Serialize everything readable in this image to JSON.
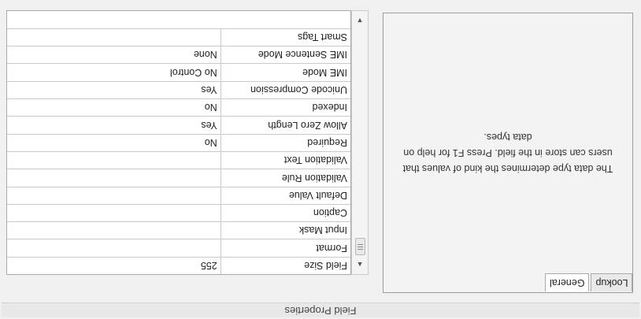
{
  "section_title": "Field Properties",
  "tabs": [
    {
      "label": "General",
      "active": true
    },
    {
      "label": "Lookup",
      "active": false
    }
  ],
  "properties": [
    {
      "name": "Field Size",
      "value": "255"
    },
    {
      "name": "Format",
      "value": ""
    },
    {
      "name": "Input Mask",
      "value": ""
    },
    {
      "name": "Caption",
      "value": ""
    },
    {
      "name": "Default Value",
      "value": ""
    },
    {
      "name": "Validation Rule",
      "value": ""
    },
    {
      "name": "Validation Text",
      "value": ""
    },
    {
      "name": "Required",
      "value": "No"
    },
    {
      "name": "Allow Zero Length",
      "value": "Yes"
    },
    {
      "name": "Indexed",
      "value": "No"
    },
    {
      "name": "Unicode Compression",
      "value": "Yes"
    },
    {
      "name": "IME Mode",
      "value": "No Control"
    },
    {
      "name": "IME Sentence Mode",
      "value": "None"
    },
    {
      "name": "Smart Tags",
      "value": ""
    }
  ],
  "help_text": "The data type determines the kind of values that\nusers can store in the field. Press F1 for help on\ndata types.",
  "scrollbar": {
    "up_icon": "scroll-up-arrow",
    "down_icon": "scroll-down-arrow"
  }
}
